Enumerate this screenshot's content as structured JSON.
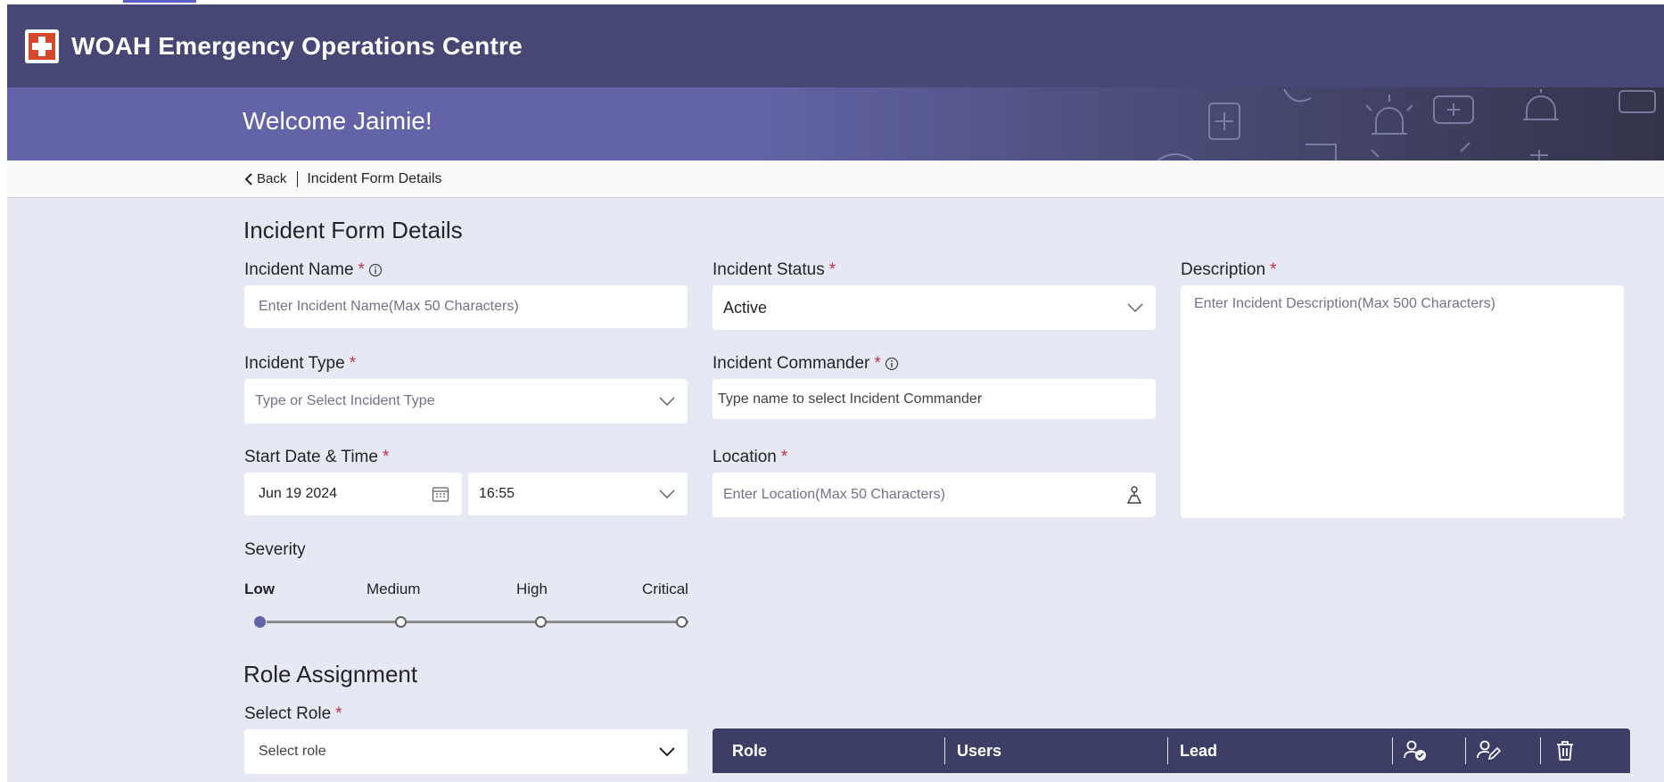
{
  "app": {
    "title": "WOAH Emergency Operations Centre"
  },
  "banner": {
    "welcome": "Welcome Jaimie!"
  },
  "breadcrumb": {
    "back": "Back",
    "current": "Incident Form Details"
  },
  "form": {
    "title": "Incident Form Details",
    "incident_name": {
      "label": "Incident Name",
      "placeholder": "Enter Incident Name(Max 50 Characters)"
    },
    "incident_status": {
      "label": "Incident Status",
      "value": "Active"
    },
    "description": {
      "label": "Description",
      "placeholder": "Enter Incident Description(Max 500 Characters)"
    },
    "incident_type": {
      "label": "Incident Type",
      "placeholder": "Type or Select Incident Type"
    },
    "incident_commander": {
      "label": "Incident Commander",
      "placeholder": "Type name to select Incident Commander"
    },
    "start_datetime": {
      "label": "Start Date & Time",
      "date": "Jun 19 2024",
      "time": "16:55"
    },
    "location": {
      "label": "Location",
      "placeholder": "Enter Location(Max 50 Characters)"
    },
    "severity": {
      "label": "Severity",
      "levels": [
        "Low",
        "Medium",
        "High",
        "Critical"
      ],
      "selected": "Low"
    }
  },
  "roles": {
    "title": "Role Assignment",
    "select_label": "Select Role",
    "select_placeholder": "Select role",
    "table_headers": [
      "Role",
      "Users",
      "Lead"
    ]
  },
  "colors": {
    "appbar": "#464775",
    "accent": "#6264a7",
    "required": "#c4314b",
    "table_header": "#3d3e66"
  }
}
